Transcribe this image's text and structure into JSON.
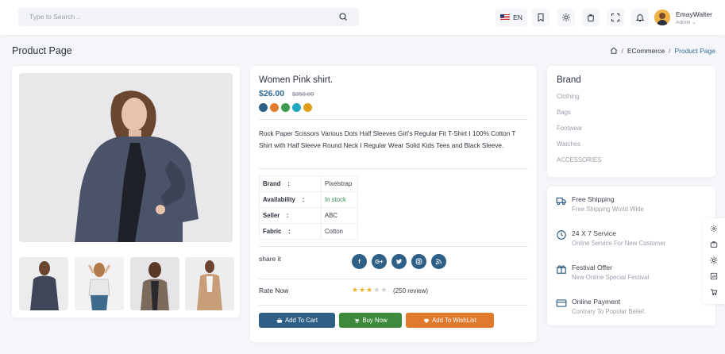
{
  "header": {
    "search_placeholder": "Type to Search ..",
    "language": "EN",
    "user": {
      "name": "EmayWalter",
      "role": "Admin"
    }
  },
  "breadcrumb": {
    "page_title": "Product Page",
    "items": [
      "ECommerce",
      "Product Page"
    ]
  },
  "product": {
    "title": "Women Pink shirt.",
    "price": "$26.00",
    "old_price": "$350.00",
    "colors": [
      "#2e5f86",
      "#e07a2c",
      "#3e9a4c",
      "#1fa8c0",
      "#e8a81e"
    ],
    "description": "Rock Paper Scissors Various Dots Half Sleeves Girl’s Regular Fit T-Shirt I 100% Cotton T Shirt with Half Sleeve Round Neck I Regular Wear Solid Kids Tees and Black Sleeve.",
    "specs": [
      {
        "key": "Brand",
        "sep": ":",
        "value": "Pixelstrap"
      },
      {
        "key": "Availability",
        "sep": ":",
        "value": "In stock"
      },
      {
        "key": "Seller",
        "sep": ":",
        "value": "ABC"
      },
      {
        "key": "Fabric",
        "sep": ":",
        "value": "Cotton"
      }
    ],
    "share_label": "share it",
    "socials": [
      "facebook-icon",
      "google-plus-icon",
      "twitter-icon",
      "instagram-icon",
      "rss-icon"
    ],
    "rate_label": "Rate Now",
    "rating": 3,
    "rating_max": 5,
    "reviews": "(250 review)",
    "buttons": {
      "add_to_cart": "Add To Cart",
      "buy_now": "Buy Now",
      "wishlist": "Add To WishList"
    }
  },
  "brand": {
    "title": "Brand",
    "items": [
      "Clothing",
      "Bags",
      "Footwear",
      "Watches",
      "ACCESSORIES"
    ]
  },
  "services": [
    {
      "icon": "truck-icon",
      "title": "Free Shipping",
      "subtitle": "Free Shipping World Wide"
    },
    {
      "icon": "clock-icon",
      "title": "24 X 7 Service",
      "subtitle": "Online Service For New Customer"
    },
    {
      "icon": "gift-icon",
      "title": "Festival Offer",
      "subtitle": "New Online Special Festival"
    },
    {
      "icon": "credit-card-icon",
      "title": "Online Payment",
      "subtitle": "Contrary To Popular Belief."
    }
  ],
  "colors": {
    "accent": "#2e6a94",
    "cart_button": "#2e5f86",
    "buy_button": "#3e8a3c",
    "wishlist_button": "#e07a2c"
  }
}
